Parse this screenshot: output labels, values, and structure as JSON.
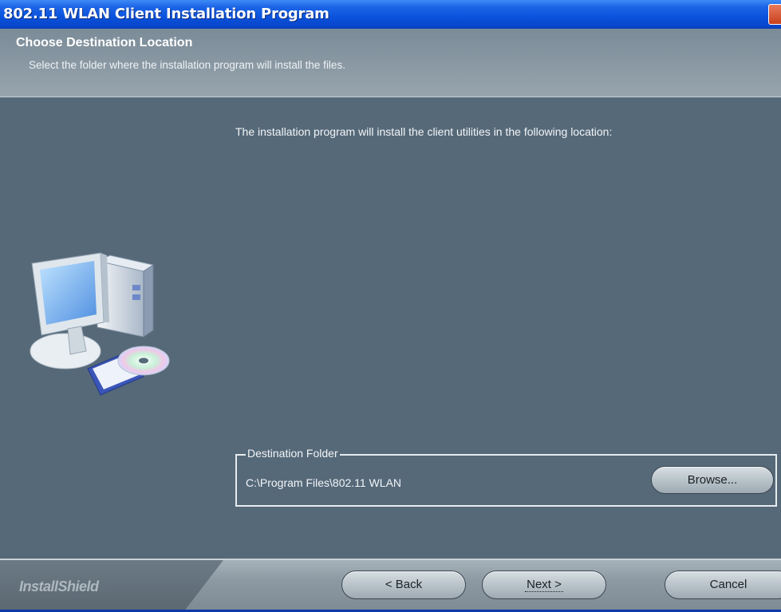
{
  "window": {
    "title": "802.11 WLAN Client Installation Program"
  },
  "header": {
    "title": "Choose Destination Location",
    "subtitle": "Select the folder where the installation program will install the files."
  },
  "main": {
    "description": "The installation program will install the client utilities in the following location:",
    "destination": {
      "group_label": "Destination Folder",
      "path": "C:\\Program Files\\802.11 WLAN",
      "browse_label": "Browse..."
    }
  },
  "footer": {
    "brand": "InstallShield",
    "back_label": "< Back",
    "next_label": "Next >",
    "cancel_label": "Cancel"
  },
  "icons": [
    "computer-installer-icon",
    "close-icon"
  ]
}
